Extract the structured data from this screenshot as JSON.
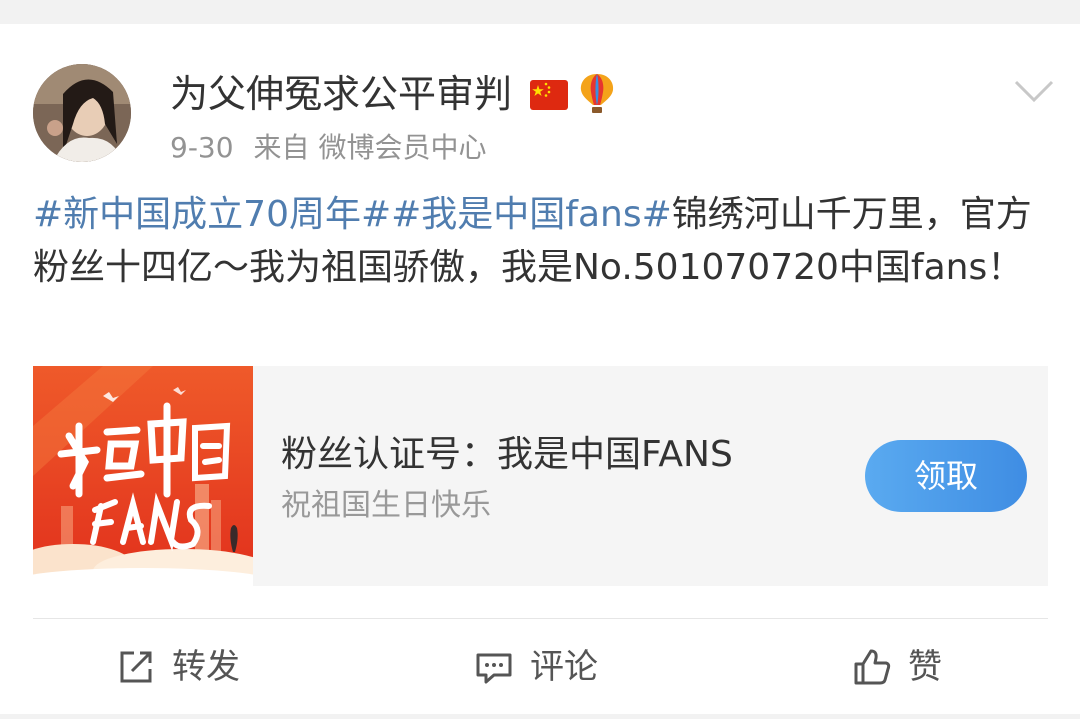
{
  "post": {
    "username": "为父伸冤求公平审判",
    "date": "9-30",
    "source_prefix": "来自",
    "source": "微博会员中心",
    "content": {
      "hashtag1": "#新中国成立70周年#",
      "hashtag2": "#我是中国fans#",
      "text": "锦绣河山千万里，官方粉丝十四亿～我为祖国骄傲，我是No.501070720中国fans！"
    },
    "link_card": {
      "image_lettering": "我是中国FANS",
      "title": "粉丝认证号：我是中国FANS",
      "subtitle": "祝祖国生日快乐",
      "button_label": "领取"
    },
    "actions": {
      "repost": "转发",
      "comment": "评论",
      "like": "赞"
    }
  },
  "icons": {
    "header": [
      "china-flag-icon",
      "hot-air-balloon-icon",
      "chevron-down-icon"
    ],
    "actions": [
      "repost-icon",
      "comment-icon",
      "like-icon"
    ]
  },
  "colors": {
    "hashtag": "#507daf",
    "button": "#4a9ae8",
    "text": "#333333",
    "meta": "#939393"
  }
}
